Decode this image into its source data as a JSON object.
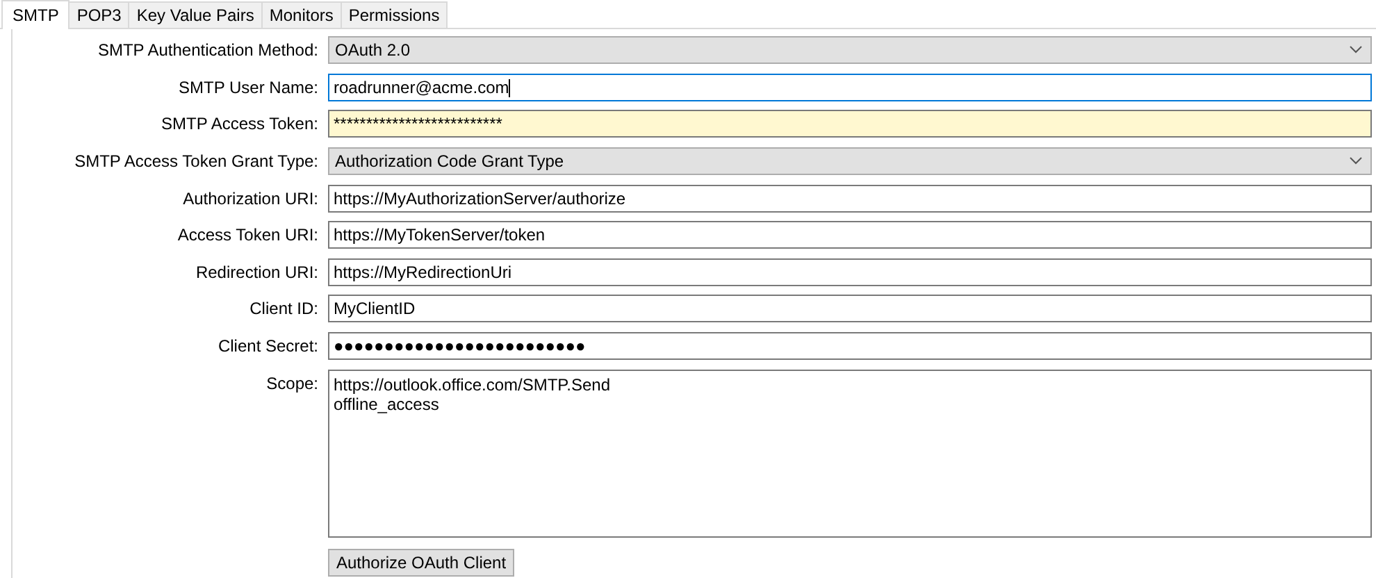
{
  "tabs": [
    {
      "label": "SMTP",
      "selected": true
    },
    {
      "label": "POP3",
      "selected": false
    },
    {
      "label": "Key Value Pairs",
      "selected": false
    },
    {
      "label": "Monitors",
      "selected": false
    },
    {
      "label": "Permissions",
      "selected": false
    }
  ],
  "fields": [
    {
      "label": "SMTP Authentication Method:",
      "kind": "select",
      "value": "OAuth 2.0"
    },
    {
      "label": "SMTP User Name:",
      "kind": "text",
      "value": "roadrunner@acme.com",
      "focused": true,
      "highlighted": false
    },
    {
      "label": "SMTP Access Token:",
      "kind": "text",
      "value": "**************************",
      "focused": false,
      "highlighted": true
    },
    {
      "label": "SMTP Access Token Grant Type:",
      "kind": "select",
      "value": "Authorization Code Grant Type"
    },
    {
      "label": "Authorization URI:",
      "kind": "text",
      "value": "https://MyAuthorizationServer/authorize",
      "focused": false,
      "highlighted": false
    },
    {
      "label": "Access Token URI:",
      "kind": "text",
      "value": "https://MyTokenServer/token",
      "focused": false,
      "highlighted": false
    },
    {
      "label": "Redirection URI:",
      "kind": "text",
      "value": "https://MyRedirectionUri",
      "focused": false,
      "highlighted": false
    },
    {
      "label": "Client ID:",
      "kind": "text",
      "value": "MyClientID",
      "focused": false,
      "highlighted": false
    },
    {
      "label": "Client Secret:",
      "kind": "password",
      "value": "●●●●●●●●●●●●●●●●●●●●●●●●●",
      "focused": false,
      "highlighted": false
    },
    {
      "label": "Scope:",
      "kind": "multiline",
      "lines": [
        "https://outlook.office.com/SMTP.Send",
        "offline_access"
      ],
      "focused": false,
      "highlighted": false
    }
  ],
  "button": "Authorize OAuth Client"
}
